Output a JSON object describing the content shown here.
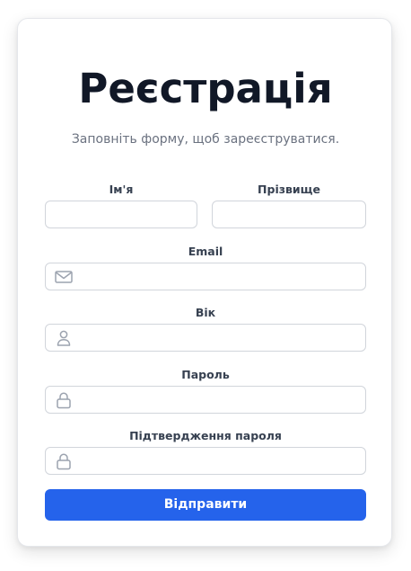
{
  "form": {
    "title": "Реєстрація",
    "subtitle": "Заповніть форму, щоб зареєструватися.",
    "fields": {
      "first_name": {
        "label": "Ім'я",
        "value": "",
        "placeholder": ""
      },
      "last_name": {
        "label": "Прізвище",
        "value": "",
        "placeholder": ""
      },
      "email": {
        "label": "Email",
        "value": "",
        "placeholder": "",
        "icon": "mail-icon"
      },
      "age": {
        "label": "Вік",
        "value": "",
        "placeholder": "",
        "icon": "user-icon"
      },
      "password": {
        "label": "Пароль",
        "value": "",
        "placeholder": "",
        "icon": "lock-icon"
      },
      "confirm_password": {
        "label": "Підтвердження пароля",
        "value": "",
        "placeholder": "",
        "icon": "lock-icon"
      }
    },
    "submit_label": "Відправити"
  },
  "colors": {
    "accent": "#2563eb",
    "title": "#111827",
    "subtitle": "#6b7280",
    "label": "#374151",
    "input_border": "#d1d5db",
    "icon": "#9ca3af"
  }
}
